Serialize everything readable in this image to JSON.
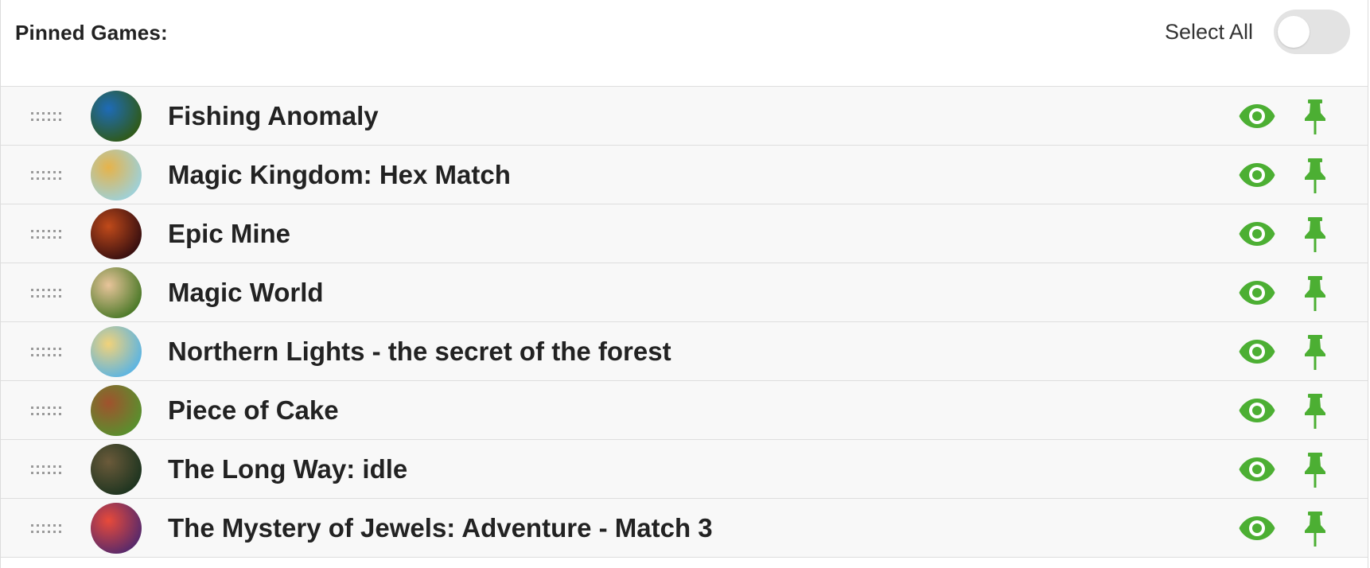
{
  "header": {
    "title": "Pinned Games:",
    "select_all_label": "Select All",
    "select_all_checked": false
  },
  "accent_color": "#4caf33",
  "games": [
    {
      "title": "Fishing Anomaly",
      "avatar_colors": [
        "#2f5a1a",
        "#1e6bb8"
      ],
      "visible": true,
      "pinned": true
    },
    {
      "title": "Magic Kingdom: Hex Match",
      "avatar_colors": [
        "#9fd0d6",
        "#e6b34a"
      ],
      "visible": true,
      "pinned": true
    },
    {
      "title": "Epic Mine",
      "avatar_colors": [
        "#3a1010",
        "#c04a1a"
      ],
      "visible": true,
      "pinned": true
    },
    {
      "title": "Magic World",
      "avatar_colors": [
        "#4e7a2a",
        "#e8c49a"
      ],
      "visible": true,
      "pinned": true
    },
    {
      "title": "Northern Lights - the secret of the forest",
      "avatar_colors": [
        "#5fb5e0",
        "#f1d27a"
      ],
      "visible": true,
      "pinned": true
    },
    {
      "title": "Piece of Cake",
      "avatar_colors": [
        "#5a8f2e",
        "#a0522d"
      ],
      "visible": true,
      "pinned": true
    },
    {
      "title": "The Long Way: idle",
      "avatar_colors": [
        "#1f3520",
        "#6b5a3a"
      ],
      "visible": true,
      "pinned": true
    },
    {
      "title": "The Mystery of Jewels: Adventure - Match 3",
      "avatar_colors": [
        "#5a2a6a",
        "#e84a3a"
      ],
      "visible": true,
      "pinned": true
    }
  ]
}
